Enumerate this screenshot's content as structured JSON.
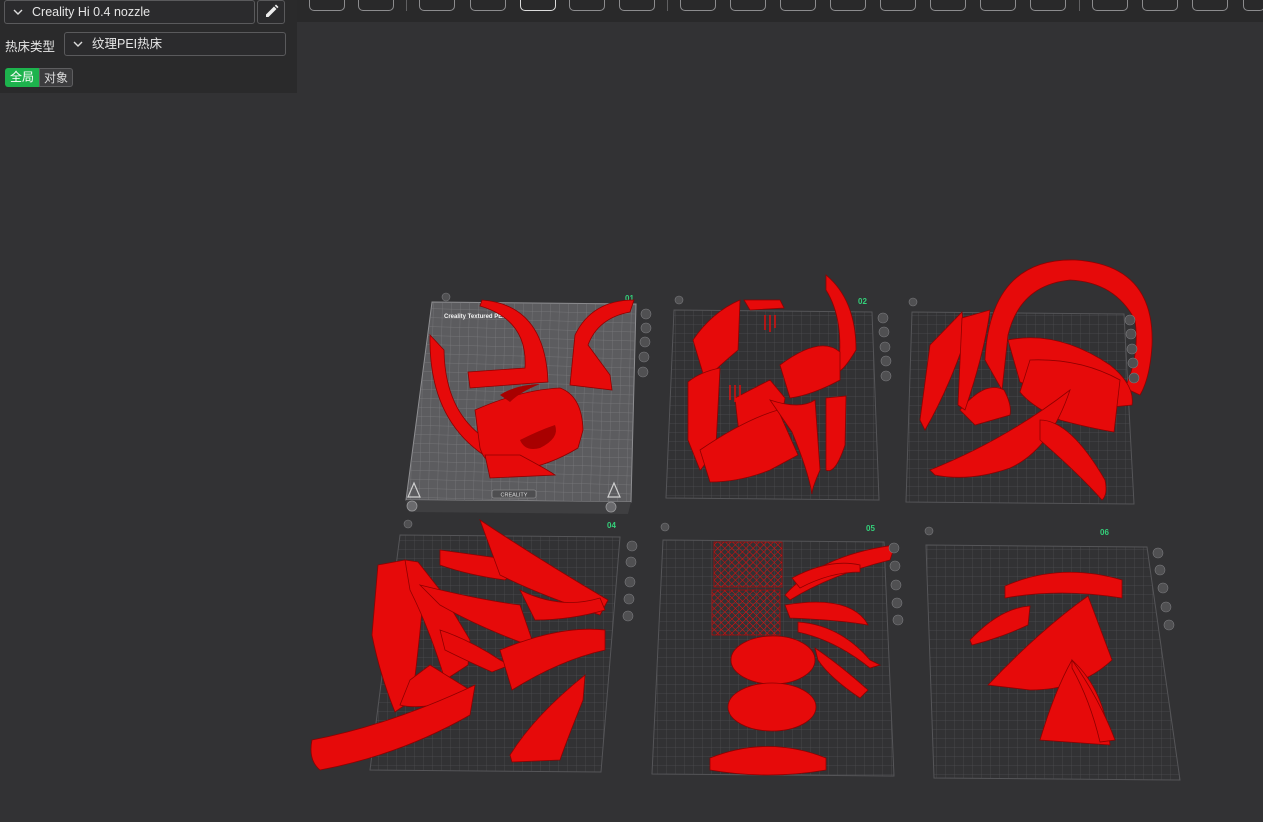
{
  "printer_selector": {
    "value": "Creality Hi 0.4 nozzle"
  },
  "bed_type": {
    "label": "热床类型",
    "value": "纹理PEI热床"
  },
  "settings_scope": {
    "global_label": "全局",
    "object_label": "对象"
  },
  "plates": [
    {
      "number": "01",
      "bed_label": "Creality Textured PEI Plate",
      "brand": "CREALITY"
    },
    {
      "number": "02"
    },
    {
      "number": ""
    },
    {
      "number": "04"
    },
    {
      "number": "05"
    },
    {
      "number": "06"
    }
  ],
  "icons": {
    "dropdown": "chevron-down-icon",
    "edit": "pencil-icon",
    "plate_tools": [
      "close-icon",
      "arrange-icon",
      "orient-icon",
      "lock-icon",
      "settings-icon"
    ]
  },
  "colors": {
    "accent": "#1db34d",
    "model": "#e60a0a",
    "plate_number": "#34d07a",
    "background": "#323234"
  }
}
